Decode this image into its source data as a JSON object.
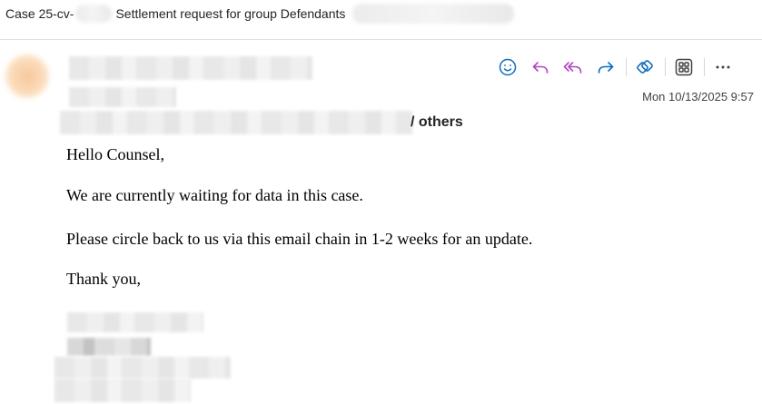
{
  "subject": {
    "prefix": "Case 25-cv-",
    "title": "Settlement request for group Defendants"
  },
  "header": {
    "recipients_suffix": "/ others",
    "timestamp": "Mon 10/13/2025 9:57"
  },
  "toolbar": {
    "icons": [
      "emoji-icon",
      "reply-icon",
      "reply-all-icon",
      "forward-icon",
      "loop-icon",
      "apps-icon",
      "more-icon"
    ],
    "accent_color": "#0f6cbd",
    "reply_color": "#b146c2"
  },
  "message": {
    "greeting": "Hello Counsel,",
    "line1": "We are currently waiting for data in this case.",
    "line2": "Please circle back to us via this email chain in 1-2 weeks for an update.",
    "closing": "Thank you,"
  }
}
